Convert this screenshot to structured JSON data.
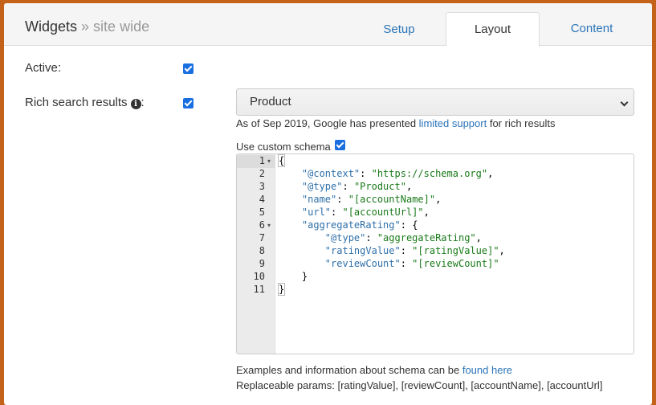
{
  "header": {
    "title": "Widgets",
    "subtitle": "» site wide",
    "tabs": {
      "setup": "Setup",
      "layout": "Layout",
      "content": "Content"
    }
  },
  "form": {
    "active_label": "Active:",
    "rich_label": "Rich search results",
    "rich_suffix": ":",
    "select_value": "Product",
    "google_note_prefix": "As of Sep 2019, Google has presented ",
    "google_note_link": "limited support",
    "google_note_suffix": " for rich results",
    "custom_schema_label": "Use custom schema",
    "examples_prefix": "Examples and information about schema can be ",
    "examples_link": "found here",
    "params_text": "Replaceable params: [ratingValue], [reviewCount], [accountName], [accountUrl]"
  },
  "editor": {
    "line_numbers": [
      "1",
      "2",
      "3",
      "4",
      "5",
      "6",
      "7",
      "8",
      "9",
      "10",
      "11"
    ],
    "lines": [
      {
        "k": "",
        "v": "{"
      },
      {
        "k": "\"@context\"",
        "v": "\"https://schema.org\","
      },
      {
        "k": "\"@type\"",
        "v": "\"Product\","
      },
      {
        "k": "\"name\"",
        "v": "\"[accountName]\","
      },
      {
        "k": "\"url\"",
        "v": "\"[accountUrl]\","
      },
      {
        "k": "\"aggregateRating\"",
        "v": "{"
      },
      {
        "k": "\"@type\"",
        "v": "\"aggregateRating\","
      },
      {
        "k": "\"ratingValue\"",
        "v": "\"[ratingValue]\","
      },
      {
        "k": "\"reviewCount\"",
        "v": "\"[reviewCount]\""
      },
      {
        "k": "",
        "v": "}"
      },
      {
        "k": "",
        "v": "}"
      }
    ]
  },
  "colors": {
    "accent": "#2a74b8",
    "checkbox": "#1a6fe0",
    "frame": "#c4621a"
  }
}
